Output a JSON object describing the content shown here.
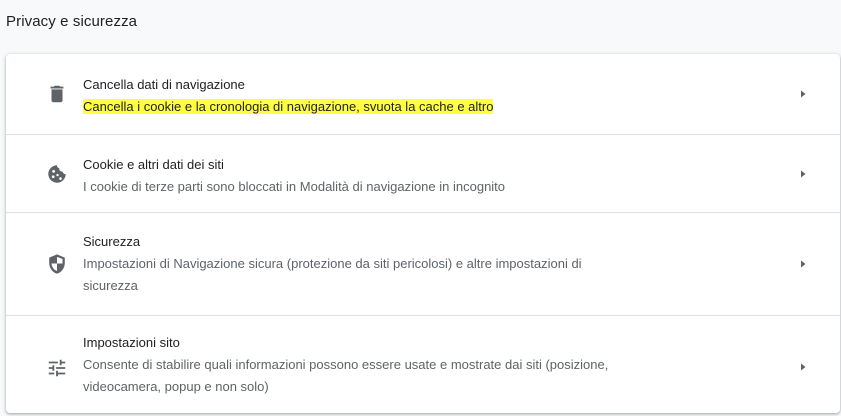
{
  "section": {
    "title": "Privacy e sicurezza"
  },
  "rows": [
    {
      "title": "Cancella dati di navigazione",
      "subtitle": "Cancella i cookie e la cronologia di navigazione, svuota la cache e altro",
      "icon": "trash-icon",
      "highlighted": true
    },
    {
      "title": "Cookie e altri dati dei siti",
      "subtitle": "I cookie di terze parti sono bloccati in Modalità di navigazione in incognito",
      "icon": "cookie-icon"
    },
    {
      "title": "Sicurezza",
      "subtitle_line1": "Impostazioni di Navigazione sicura (protezione da siti pericolosi) e altre impostazioni di",
      "subtitle_line2": "sicurezza",
      "icon": "shield-icon"
    },
    {
      "title": "Impostazioni sito",
      "subtitle_line1": "Consente di stabilire quali informazioni possono essere usate e mostrate dai siti (posizione,",
      "subtitle_line2": "videocamera, popup e non solo)",
      "icon": "tune-icon"
    }
  ],
  "colors": {
    "background": "#f8f9fa",
    "card": "#ffffff",
    "icon": "#5f6368",
    "highlight": "#ffff42"
  }
}
